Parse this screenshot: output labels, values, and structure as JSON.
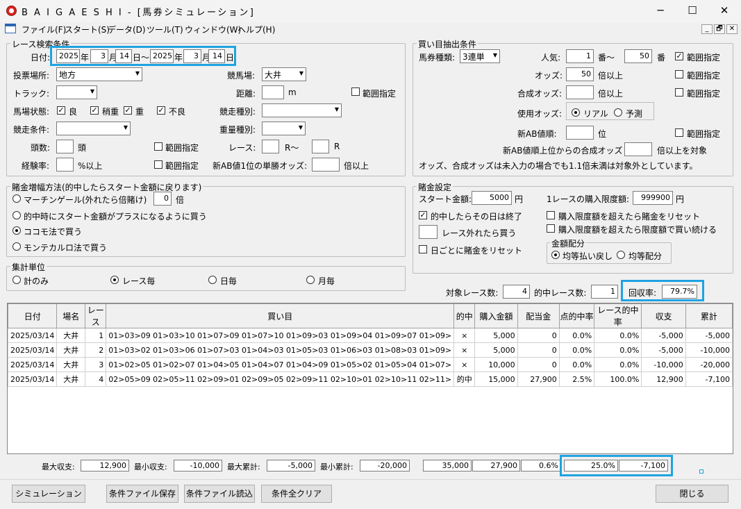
{
  "window": {
    "title": "B A I G A E S H I - [馬券シミュレーション]",
    "min": "─",
    "max": "☐",
    "close": "✕"
  },
  "menu": [
    "ファイル(F)",
    "スタート(S)",
    "データ(D)",
    "ツール(T)",
    "ウィンドウ(W)",
    "ヘルプ(H)"
  ],
  "mdi": {
    "min": "_",
    "restore": "🗗",
    "close": "✕"
  },
  "race": {
    "title": "レース検索条件",
    "date_label": "日付:",
    "y1": "2025",
    "y_unit": "年",
    "m1": "3",
    "m_unit": "月",
    "d1": "14",
    "tilde": "日〜",
    "y2": "2025",
    "m2": "3",
    "d2": "14",
    "d_unit": "日",
    "voting_label": "投票場所:",
    "voting_value": "地方",
    "track_label": "競馬場:",
    "track_value": "大井",
    "trk_label": "トラック:",
    "trk_value": "",
    "dist_label": "距離:",
    "dist_unit": "m",
    "dist_range": "範囲指定",
    "cond_label": "馬場状態:",
    "cond1": "良",
    "cond2": "稍重",
    "cond3": "重",
    "cond4": "不良",
    "type_label": "競走種別:",
    "type_value": "",
    "kcond_label": "競走条件:",
    "kcond_value": "",
    "weight_label": "重量種別:",
    "weight_value": "",
    "heads_label": "頭数:",
    "heads_unit": "頭",
    "heads_range": "範囲指定",
    "race_label": "レース:",
    "race_r1": "R〜",
    "race_r2": "R",
    "exp_label": "経験率:",
    "exp_unit": "%以上",
    "exp_range": "範囲指定",
    "ab_label": "新AB値1位の単勝オッズ:",
    "ab_unit": "倍以上"
  },
  "bet": {
    "title": "買い目抽出条件",
    "type_label": "馬券種類:",
    "type_value": "3連単",
    "pop_label": "人気:",
    "pop_from": "1",
    "pop_mid": "番〜",
    "pop_to": "50",
    "pop_unit": "番",
    "pop_range": "範囲指定",
    "odds_label": "オッズ:",
    "odds_value": "50",
    "odds_unit": "倍以上",
    "odds_range": "範囲指定",
    "codds_label": "合成オッズ:",
    "codds_unit": "倍以上",
    "codds_range": "範囲指定",
    "use_label": "使用オッズ:",
    "use_real": "リアル",
    "use_pred": "予測",
    "abr_label": "新AB値順:",
    "abr_unit": "位",
    "abr_range": "範囲指定",
    "abtop_label": "新AB値順上位からの合成オッズ",
    "abtop_unit": "倍以上を対象",
    "note": "オッズ、合成オッズは未入力の場合でも1.1倍未満は対象外としています。"
  },
  "method": {
    "title": "賭金増幅方法(的中したらスタート金額に戻ります)",
    "m1": "マーチンゲール(外れたら倍賭け)",
    "m1_value": "0",
    "m1_unit": "倍",
    "m2": "的中時にスタート金額がプラスになるように買う",
    "m3": "ココモ法で買う",
    "m4": "モンテカルロ法で買う"
  },
  "money": {
    "title": "賭金設定",
    "start_label": "スタート金額:",
    "start_value": "5000",
    "start_unit": "円",
    "limit_label": "1レースの購入限度額:",
    "limit_value": "999900",
    "limit_unit": "円",
    "stop_label": "的中したらその日は終了",
    "miss_label": "レース外れたら買う",
    "reset_label": "日ごとに賭金をリセット",
    "over1": "購入限度額を超えたら賭金をリセット",
    "over2": "購入限度額を超えたら限度額で買い続ける",
    "alloc_title": "金額配分",
    "alloc1": "均等払い戻し",
    "alloc2": "均等配分"
  },
  "unit": {
    "title": "集計単位",
    "u1": "計のみ",
    "u2": "レース毎",
    "u3": "日毎",
    "u4": "月毎"
  },
  "stats": {
    "target_label": "対象レース数:",
    "target_value": "4",
    "hit_label": "的中レース数:",
    "hit_value": "1",
    "rate_label": "回収率:",
    "rate_value": "79.7%"
  },
  "table": {
    "headers": [
      "日付",
      "場名",
      "レース",
      "買い目",
      "的中",
      "購入金額",
      "配当金",
      "点的中率",
      "レース的中率",
      "収支",
      "累計"
    ],
    "rows": [
      [
        "2025/03/14",
        "大井",
        "1",
        "01>03>09 01>03>10 01>07>09 01>07>10 01>09>03 01>09>04 01>09>07 01>09>",
        "×",
        "5,000",
        "0",
        "0.0%",
        "0.0%",
        "-5,000",
        "-5,000"
      ],
      [
        "2025/03/14",
        "大井",
        "2",
        "01>03>02 01>03>06 01>07>03 01>04>03 01>05>03 01>06>03 01>08>03 01>09>",
        "×",
        "5,000",
        "0",
        "0.0%",
        "0.0%",
        "-5,000",
        "-10,000"
      ],
      [
        "2025/03/14",
        "大井",
        "3",
        "01>02>05 01>02>07 01>04>05 01>04>07 01>04>09 01>05>02 01>05>04 01>07>",
        "×",
        "10,000",
        "0",
        "0.0%",
        "0.0%",
        "-10,000",
        "-20,000"
      ],
      [
        "2025/03/14",
        "大井",
        "4",
        "02>05>09 02>05>11 02>09>01 02>09>05 02>09>11 02>10>01 02>10>11 02>11>",
        "的中",
        "15,000",
        "27,900",
        "2.5%",
        "100.0%",
        "12,900",
        "-7,100"
      ]
    ]
  },
  "summary": {
    "max_income_label": "最大収支:",
    "max_income": "12,900",
    "min_income_label": "最小収支:",
    "min_income": "-10,000",
    "max_cum_label": "最大累計:",
    "max_cum": "-5,000",
    "min_cum_label": "最小累計:",
    "min_cum": "-20,000",
    "total_buy": "35,000",
    "total_pay": "27,900",
    "point_rate": "0.6%",
    "race_rate": "25.0%",
    "cum": "-7,100"
  },
  "buttons": {
    "sim": "シミュレーション",
    "save": "条件ファイル保存",
    "load": "条件ファイル読込",
    "clear": "条件全クリア",
    "close": "閉じる"
  }
}
